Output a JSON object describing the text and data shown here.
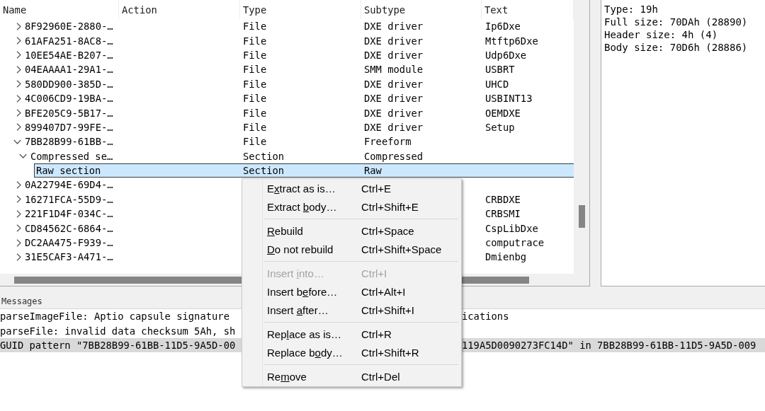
{
  "tree": {
    "columns": [
      "Name",
      "Action",
      "Type",
      "Subtype",
      "Text"
    ],
    "items": [
      {
        "name": "8F92960E-2880-…",
        "type": "File",
        "subtype": "DXE driver",
        "text": "Ip6Dxe",
        "expanded": false,
        "selected": false
      },
      {
        "name": "61AFA251-8AC8-…",
        "type": "File",
        "subtype": "DXE driver",
        "text": "Mtftp6Dxe",
        "expanded": false,
        "selected": false
      },
      {
        "name": "10EE54AE-B207-…",
        "type": "File",
        "subtype": "DXE driver",
        "text": "Udp6Dxe",
        "expanded": false,
        "selected": false
      },
      {
        "name": "04EAAAA1-29A1-…",
        "type": "File",
        "subtype": "SMM module",
        "text": "USBRT",
        "expanded": false,
        "selected": false
      },
      {
        "name": "580DD900-385D-…",
        "type": "File",
        "subtype": "DXE driver",
        "text": "UHCD",
        "expanded": false,
        "selected": false
      },
      {
        "name": "4C006CD9-19BA-…",
        "type": "File",
        "subtype": "DXE driver",
        "text": "USBINT13",
        "expanded": false,
        "selected": false
      },
      {
        "name": "BFE205C9-5B17-…",
        "type": "File",
        "subtype": "DXE driver",
        "text": "OEMDXE",
        "expanded": false,
        "selected": false
      },
      {
        "name": "899407D7-99FE-…",
        "type": "File",
        "subtype": "DXE driver",
        "text": "Setup",
        "expanded": false,
        "selected": false
      },
      {
        "name": "7BB28B99-61BB-…",
        "type": "File",
        "subtype": "Freeform",
        "expanded": true,
        "selected": false,
        "children": [
          {
            "name": "Compressed se…",
            "type": "Section",
            "subtype": "Compressed",
            "expanded": true,
            "selected": false,
            "children": [
              {
                "name": "Raw section",
                "type": "Section",
                "subtype": "Raw",
                "selected": true
              }
            ]
          }
        ]
      },
      {
        "name": "0A22794E-69D4-…",
        "expanded": false,
        "selected": false
      },
      {
        "name": "16271FCA-55D9-…",
        "text": "CRBDXE",
        "expanded": false,
        "selected": false
      },
      {
        "name": "221F1D4F-034C-…",
        "text": "CRBSMI",
        "expanded": false,
        "selected": false
      },
      {
        "name": "CD84562C-6864-…",
        "text": "CspLibDxe",
        "expanded": false,
        "selected": false
      },
      {
        "name": "DC2AA475-F939-…",
        "text": "computrace",
        "expanded": false,
        "selected": false
      },
      {
        "name": "31E5CAF3-A471-…",
        "text": "Dmienbg",
        "expanded": false,
        "selected": false
      }
    ]
  },
  "info_panel": {
    "lines": [
      "Type: 19h",
      "Full size: 70DAh (28890)",
      "Header size: 4h (4)",
      "Body size: 70D6h (28886)"
    ]
  },
  "messages": {
    "title": "Messages",
    "lines": [
      {
        "text_start": "parseImageFile: Aptio capsule signature",
        "text_end": "ications",
        "selected": false
      },
      {
        "text_start": "parseFile: invalid data checksum 5Ah, sh",
        "selected": false
      },
      {
        "text_start": "GUID pattern \"7BB28B99-61BB-11D5-9A5D-00",
        "text_end": "119A5D0090273FC14D\" in 7BB28B99-61BB-11D5-9A5D-009",
        "selected": true
      }
    ]
  },
  "context_menu": {
    "groups": [
      [
        {
          "label_start": "E",
          "mnemonic": "x",
          "label_end": "tract as is…",
          "shortcut": "Ctrl+E",
          "disabled": false
        },
        {
          "label_start": "Extract ",
          "mnemonic": "b",
          "label_end": "ody…",
          "shortcut": "Ctrl+Shift+E",
          "disabled": false
        }
      ],
      [
        {
          "mnemonic": "R",
          "label_end": "ebuild",
          "shortcut": "Ctrl+Space",
          "disabled": false
        },
        {
          "mnemonic": "D",
          "label_end": "o not rebuild",
          "shortcut": "Ctrl+Shift+Space",
          "disabled": false
        }
      ],
      [
        {
          "label_start": "Insert ",
          "mnemonic": "i",
          "label_end": "nto…",
          "shortcut": "Ctrl+I",
          "disabled": true
        },
        {
          "label_start": "Insert b",
          "mnemonic": "e",
          "label_end": "fore…",
          "shortcut": "Ctrl+Alt+I",
          "disabled": false
        },
        {
          "label_start": "Insert ",
          "mnemonic": "a",
          "label_end": "fter…",
          "shortcut": "Ctrl+Shift+I",
          "disabled": false
        }
      ],
      [
        {
          "label_start": "Rep",
          "mnemonic": "l",
          "label_end": "ace as is…",
          "shortcut": "Ctrl+R",
          "disabled": false
        },
        {
          "label_start": "Replace b",
          "mnemonic": "o",
          "label_end": "dy…",
          "shortcut": "Ctrl+Shift+R",
          "disabled": false
        }
      ],
      [
        {
          "label_start": "Re",
          "mnemonic": "m",
          "label_end": "ove",
          "shortcut": "Ctrl+Del",
          "disabled": false
        }
      ]
    ]
  }
}
